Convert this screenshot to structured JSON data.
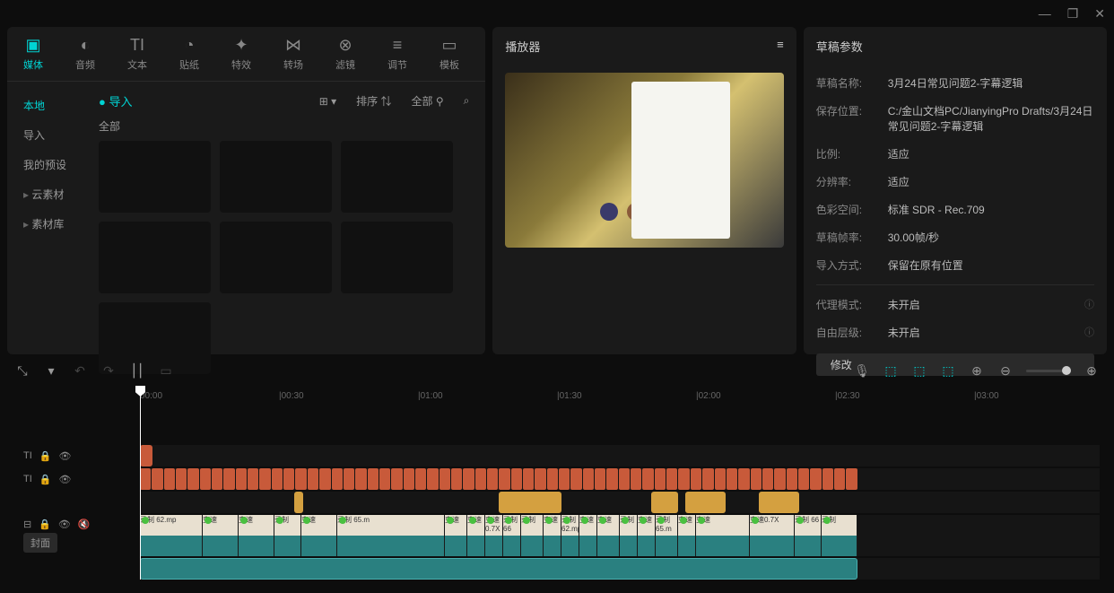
{
  "window": {
    "min": "—",
    "max": "❐",
    "close": "✕"
  },
  "topnav": [
    {
      "icon": "▣",
      "label": "媒体"
    },
    {
      "icon": "◐",
      "label": "音频"
    },
    {
      "icon": "TI",
      "label": "文本"
    },
    {
      "icon": "◔",
      "label": "贴纸"
    },
    {
      "icon": "✦",
      "label": "特效"
    },
    {
      "icon": "⋈",
      "label": "转场"
    },
    {
      "icon": "⊗",
      "label": "滤镜"
    },
    {
      "icon": "≡",
      "label": "调节"
    },
    {
      "icon": "▭",
      "label": "模板"
    }
  ],
  "sidebar": [
    {
      "label": "本地",
      "active": true
    },
    {
      "label": "导入"
    },
    {
      "label": "我的预设"
    },
    {
      "label": "云素材",
      "arrow": true
    },
    {
      "label": "素材库",
      "arrow": true
    }
  ],
  "media": {
    "import": "导入",
    "view": "⊞ ▾",
    "sort": "排序 ⇅",
    "filter": "全部 ⚲",
    "search": "⌕",
    "all": "全部"
  },
  "player": {
    "title": "播放器",
    "menu": "≡"
  },
  "params": {
    "title": "草稿参数",
    "rows": [
      {
        "label": "草稿名称:",
        "value": "3月24日常见问题2-字幕逻辑"
      },
      {
        "label": "保存位置:",
        "value": "C:/金山文档PC/JianyingPro Drafts/3月24日常见问题2-字幕逻辑"
      },
      {
        "label": "比例:",
        "value": "适应"
      },
      {
        "label": "分辨率:",
        "value": "适应"
      },
      {
        "label": "色彩空间:",
        "value": "标准 SDR - Rec.709"
      },
      {
        "label": "草稿帧率:",
        "value": "30.00帧/秒"
      },
      {
        "label": "导入方式:",
        "value": "保留在原有位置"
      }
    ],
    "rows2": [
      {
        "label": "代理模式:",
        "value": "未开启",
        "info": true
      },
      {
        "label": "自由层级:",
        "value": "未开启",
        "info": true
      }
    ],
    "modify": "修改"
  },
  "toolbar": {
    "cursor": "⤡",
    "dd": "▾",
    "undo": "↶",
    "redo": "↷",
    "split": "⎮⎮",
    "del": "▭",
    "mic": "🎙",
    "t1": "⬚",
    "t2": "⬚",
    "t3": "⬚",
    "align": "⊕",
    "zoom_out": "⊖",
    "zoom_in": "⊕"
  },
  "ruler": [
    "00:00",
    "|00:30",
    "|01:00",
    "|01:30",
    "|02:00",
    "|02:30",
    "|03:00"
  ],
  "tracks": {
    "text": "TI",
    "lock": "🔒",
    "eye": "👁",
    "mute": "🔇",
    "cover": "封面",
    "clip_labels": [
      "录制 62.mp",
      "变速",
      "变速",
      "录制",
      "变速",
      "录制 65.m",
      "变速",
      "变速",
      "变速0.7X",
      "录制 66",
      "录制",
      "变速"
    ]
  }
}
